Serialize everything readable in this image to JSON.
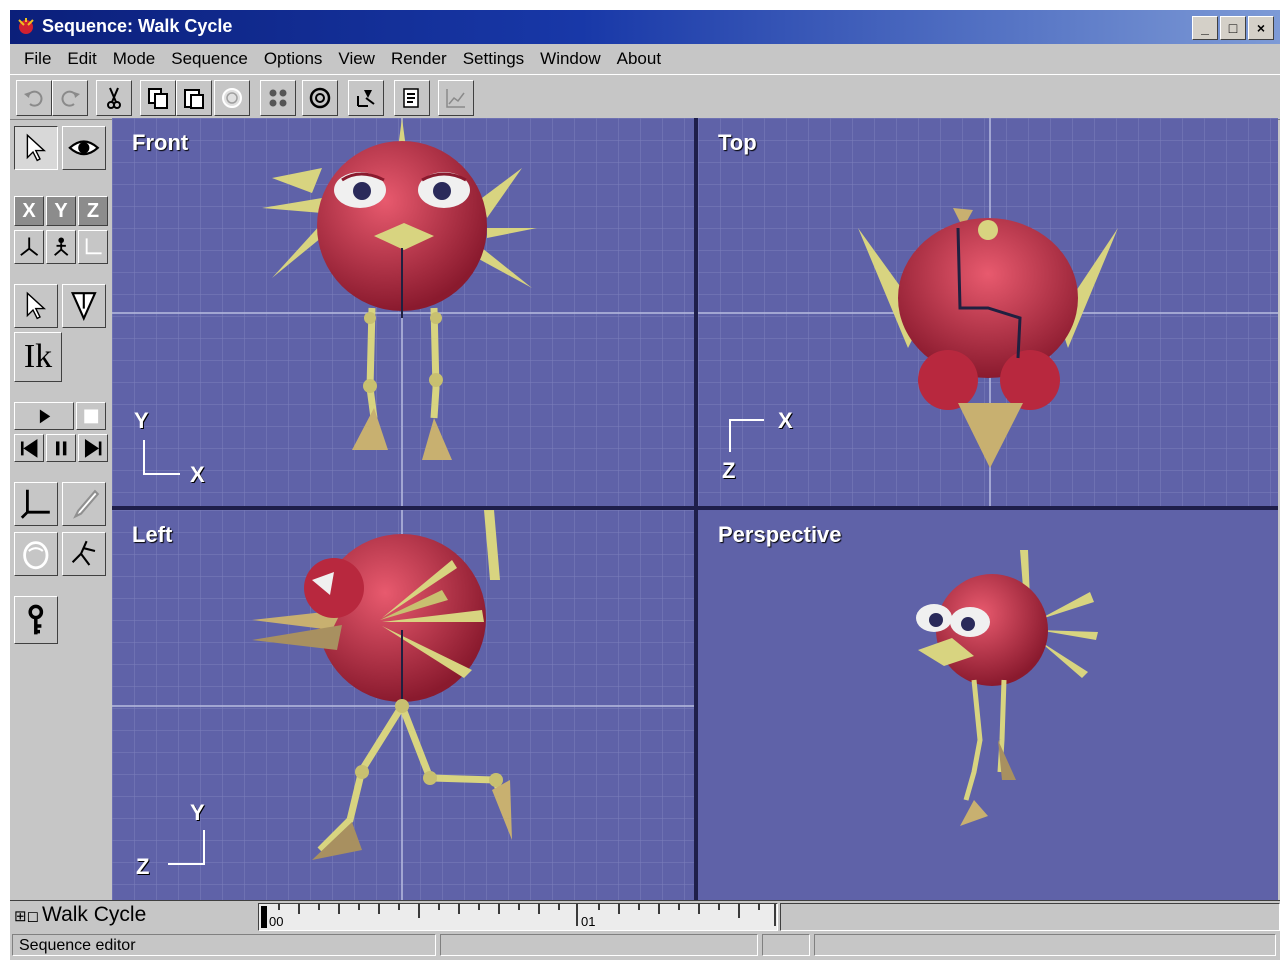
{
  "window": {
    "title": "Sequence: Walk Cycle",
    "controls": [
      "_",
      "□",
      "×"
    ]
  },
  "menubar": {
    "items": [
      "File",
      "Edit",
      "Mode",
      "Sequence",
      "Options",
      "View",
      "Render",
      "Settings",
      "Window",
      "About"
    ]
  },
  "toolbar": {
    "buttons": [
      "undo-icon",
      "redo-icon",
      "cut-icon",
      "copy-icon",
      "paste-icon",
      "render-sphere-icon",
      "grid-icon",
      "target-icon",
      "move-icon",
      "script-icon",
      "graph-icon"
    ]
  },
  "sidepanel": {
    "axis_x": "X",
    "axis_y": "Y",
    "axis_z": "Z",
    "ik_label": "Ik"
  },
  "viewports": {
    "front": {
      "label": "Front",
      "axis_v": "Y",
      "axis_h": "X"
    },
    "top": {
      "label": "Top",
      "axis_v": "Z",
      "axis_h": "X"
    },
    "left": {
      "label": "Left",
      "axis_v": "Y",
      "axis_h": "Z"
    },
    "perspective": {
      "label": "Perspective"
    }
  },
  "timeline": {
    "sequence_name": "Walk Cycle",
    "ticks": [
      "00",
      "01"
    ]
  },
  "statusbar": {
    "text": "Sequence editor"
  },
  "colors": {
    "viewport_bg": "#5f62a8",
    "titlebar": "#0b1f7a",
    "character_body": "#c8304a",
    "limbs": "#d8d480"
  }
}
